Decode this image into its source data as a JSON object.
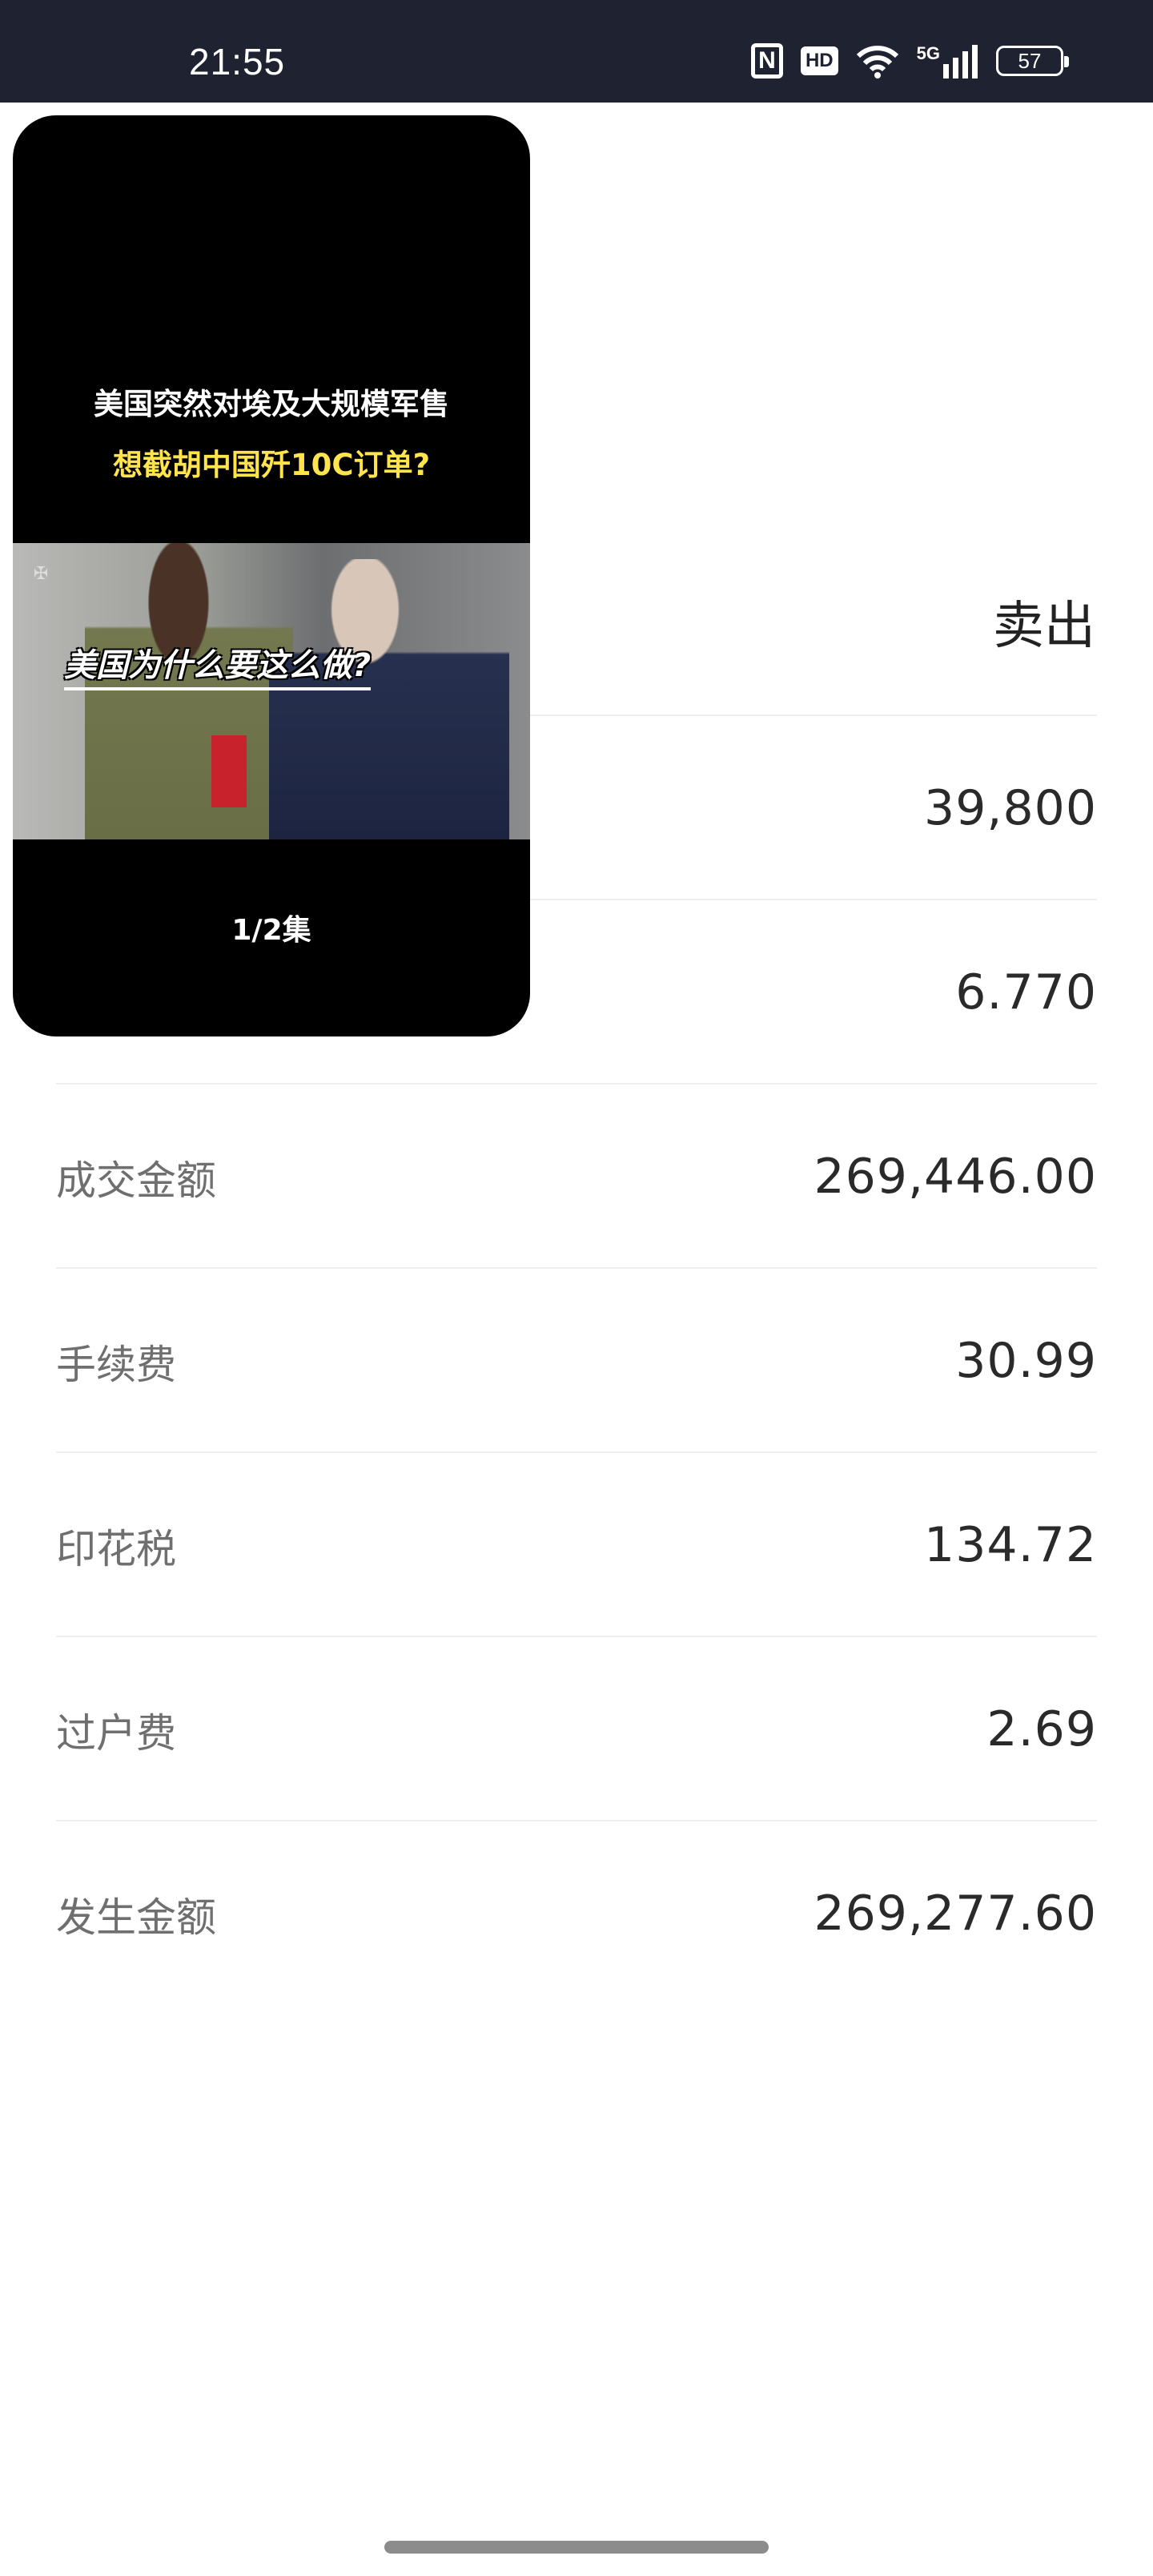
{
  "status_bar": {
    "time": "21:55",
    "nfc": "N",
    "hd": "HD",
    "network": "5G",
    "battery": "57"
  },
  "header": {
    "action": "卖出"
  },
  "rows": [
    {
      "label": "",
      "value": "39,800"
    },
    {
      "label": "",
      "value": "6.770"
    },
    {
      "label": "成交金额",
      "value": "269,446.00"
    },
    {
      "label": "手续费",
      "value": "30.99"
    },
    {
      "label": "印花税",
      "value": "134.72"
    },
    {
      "label": "过户费",
      "value": "2.69"
    },
    {
      "label": "发生金额",
      "value": "269,277.60"
    }
  ],
  "video": {
    "title_line1": "美国突然对埃及大规模军售",
    "title_line2": "想截胡中国歼10C订单?",
    "caption": "美国为什么要这么做?",
    "episode": "1/2集",
    "title_color_1": "#ffffff",
    "title_color_2": "#ffe44d"
  }
}
